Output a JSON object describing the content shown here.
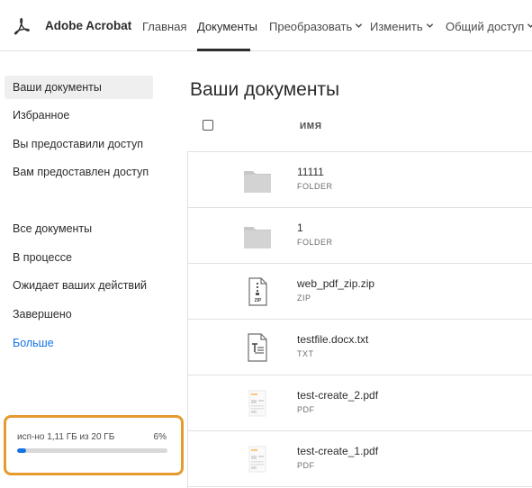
{
  "app": {
    "brand": "Adobe Acrobat"
  },
  "nav": {
    "items": [
      {
        "label": "Главная",
        "has_menu": false,
        "active": false
      },
      {
        "label": "Документы",
        "has_menu": false,
        "active": true
      },
      {
        "label": "Преобразовать",
        "has_menu": true,
        "active": false
      },
      {
        "label": "Изменить",
        "has_menu": true,
        "active": false
      },
      {
        "label": "Общий доступ",
        "has_menu": true,
        "active": false
      }
    ]
  },
  "sidebar": {
    "items": [
      {
        "label": "Ваши документы",
        "selected": true
      },
      {
        "label": "Избранное",
        "selected": false
      },
      {
        "label": "Вы предоставили доступ",
        "selected": false
      },
      {
        "label": "Вам предоставлен доступ",
        "selected": false
      },
      {
        "label": "Все документы",
        "selected": false
      },
      {
        "label": "В процессе",
        "selected": false
      },
      {
        "label": "Ожидает ваших действий",
        "selected": false
      },
      {
        "label": "Завершено",
        "selected": false
      },
      {
        "label": "Больше",
        "selected": false
      }
    ]
  },
  "storage": {
    "text": "исп-но 1,11 ГБ из 20 ГБ",
    "percent_label": "6%",
    "fraction": 0.06
  },
  "main": {
    "title": "Ваши документы",
    "column_name": "ИМЯ",
    "files": [
      {
        "name": "11111",
        "type": "FOLDER",
        "icon": "folder-icon"
      },
      {
        "name": "1",
        "type": "FOLDER",
        "icon": "folder-icon"
      },
      {
        "name": "web_pdf_zip.zip",
        "type": "ZIP",
        "icon": "zip-file-icon"
      },
      {
        "name": "testfile.docx.txt",
        "type": "TXT",
        "icon": "txt-file-icon"
      },
      {
        "name": "test-create_2.pdf",
        "type": "PDF",
        "icon": "pdf-thumbnail-icon"
      },
      {
        "name": "test-create_1.pdf",
        "type": "PDF",
        "icon": "pdf-thumbnail-icon"
      }
    ]
  },
  "colors": {
    "accent": "#1473e6",
    "highlight_border": "#e69a2d",
    "selected_bg": "#efefef",
    "acrobat_red": "#e1251b"
  }
}
